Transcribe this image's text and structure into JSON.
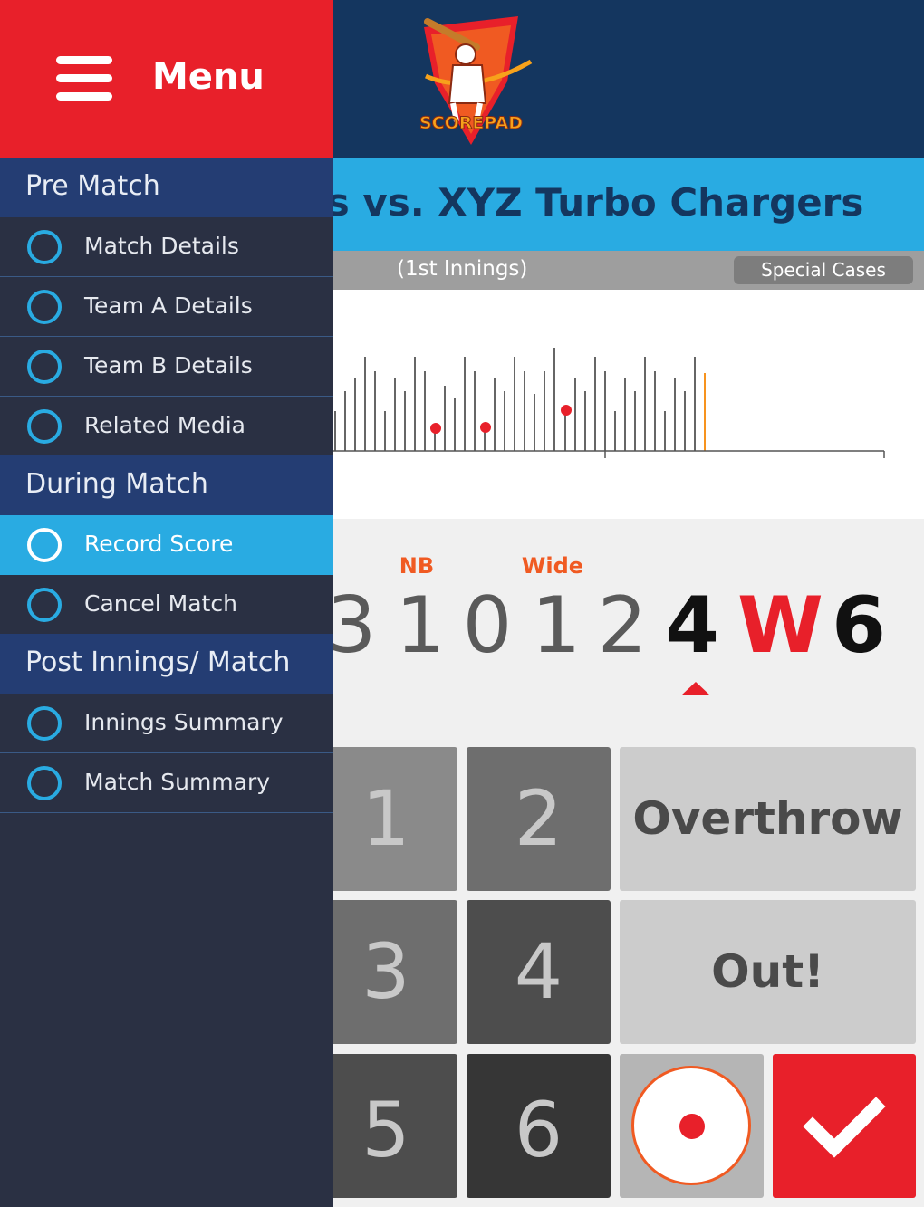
{
  "header": {
    "logo_text": "SCOREPAD"
  },
  "match": {
    "title": "rs vs. XYZ Turbo Chargers",
    "innings": "(1st Innings)",
    "special_cases": "Special Cases"
  },
  "balls": {
    "items": [
      {
        "value": "3",
        "tag": ""
      },
      {
        "value": "1",
        "tag": "NB"
      },
      {
        "value": "0",
        "tag": ""
      },
      {
        "value": "1",
        "tag": "Wide"
      },
      {
        "value": "2",
        "tag": ""
      },
      {
        "value": "4",
        "tag": ""
      },
      {
        "value": "W",
        "tag": ""
      },
      {
        "value": "6",
        "tag": ""
      }
    ],
    "current_index": 5
  },
  "keypad": {
    "keys": [
      "1",
      "2",
      "3",
      "4",
      "5",
      "6"
    ],
    "overthrow": "Overthrow",
    "out": "Out!"
  },
  "drawer": {
    "title": "Menu",
    "sections": [
      {
        "title": "Pre Match",
        "items": [
          "Match Details",
          "Team A Details",
          "Team B Details",
          "Related Media"
        ]
      },
      {
        "title": "During Match",
        "items": [
          "Record Score",
          "Cancel Match"
        ]
      },
      {
        "title": "Post Innings/ Match",
        "items": [
          "Innings Summary",
          "Match Summary"
        ]
      }
    ],
    "active_item": "Record Score"
  },
  "colors": {
    "header_navy": "#14365f",
    "accent_blue": "#29abe2",
    "accent_red": "#e8202a",
    "extras_orange": "#f05a22",
    "drawer_bg": "#2a3043",
    "section_bg": "#243d73"
  }
}
